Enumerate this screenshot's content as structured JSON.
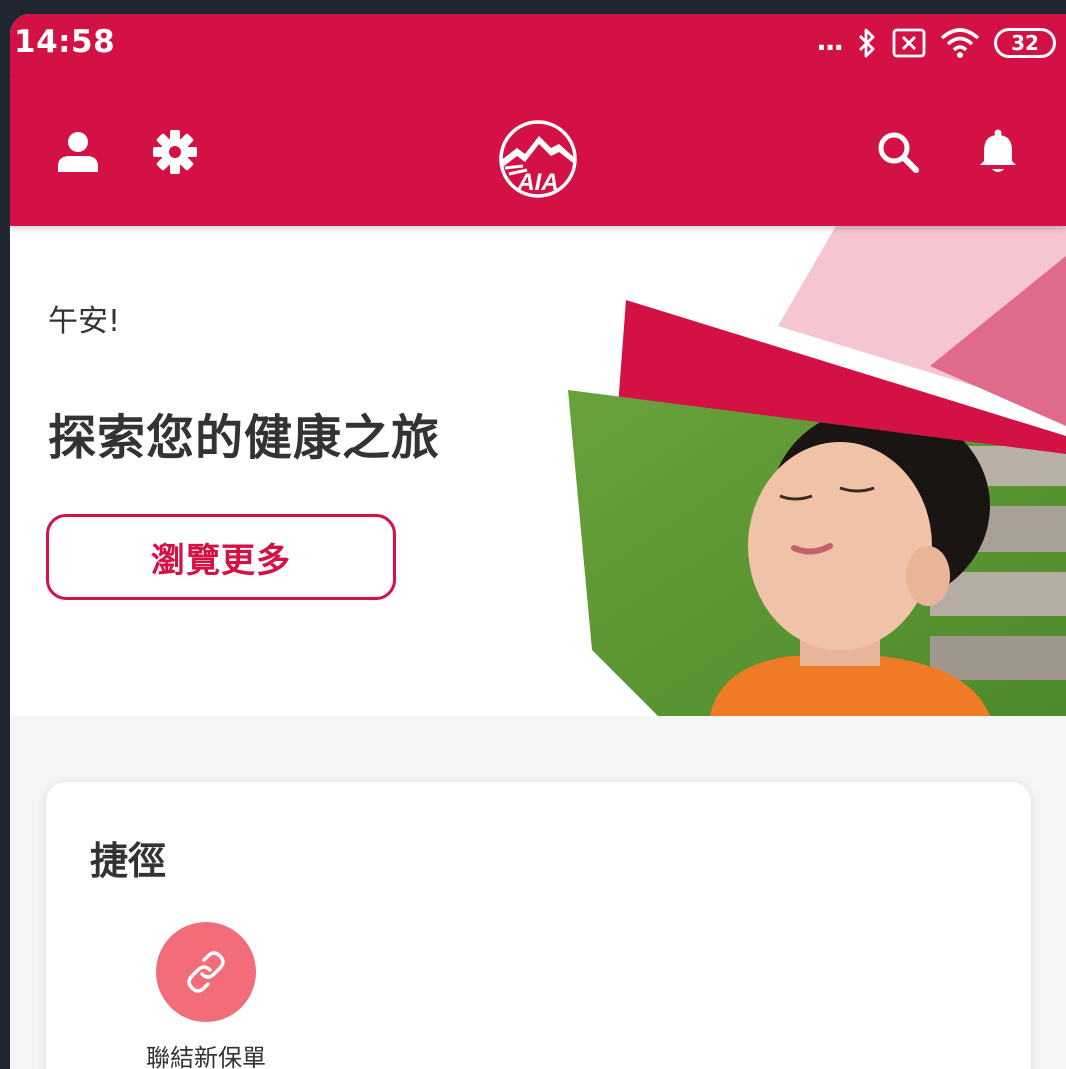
{
  "status_bar": {
    "time": "14:58",
    "dots": "...",
    "battery": "32"
  },
  "app_bar": {
    "logo_text": "AIA",
    "icons": [
      "user-icon",
      "gear-icon",
      "search-icon",
      "bell-icon"
    ]
  },
  "hero": {
    "greeting": "午安!",
    "title": "探索您的健康之旅",
    "button_label": "瀏覽更多"
  },
  "shortcuts": {
    "title": "捷徑",
    "items": [
      {
        "label": "聯結新保單",
        "icon": "link-icon"
      }
    ]
  },
  "colors": {
    "brand": "#d31145",
    "shortcut_circle": "#f26c7a",
    "pink_light": "#f5c6d2",
    "pink_mid": "#e06a8a"
  }
}
